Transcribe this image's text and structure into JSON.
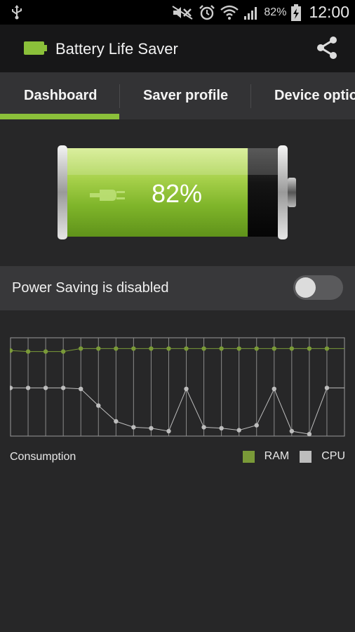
{
  "status_bar": {
    "battery_percent": "82%",
    "time": "12:00",
    "icons": [
      "usb-icon",
      "mute-icon",
      "alarm-icon",
      "wifi-icon",
      "signal-icon",
      "battery-charging-icon"
    ]
  },
  "app": {
    "title": "Battery Life Saver",
    "icon": "battery-icon",
    "share_icon": "share-icon"
  },
  "tabs": [
    {
      "label": "Dashboard",
      "selected": true
    },
    {
      "label": "Saver profile",
      "selected": false
    },
    {
      "label": "Device options",
      "selected": false
    }
  ],
  "battery": {
    "level_text": "82%",
    "level_fraction": 0.82,
    "plug_icon": "plug-icon"
  },
  "power_saving": {
    "label": "Power Saving is disabled",
    "enabled": false
  },
  "colors": {
    "accent": "#8bc03a",
    "ram": "#7a9a38",
    "cpu": "#bdbdbd"
  },
  "chart_data": {
    "type": "line",
    "x": [
      1,
      2,
      3,
      4,
      5,
      6,
      7,
      8,
      9,
      10,
      11,
      12,
      13,
      14,
      15,
      16,
      17,
      18,
      19
    ],
    "series": [
      {
        "name": "RAM",
        "values": [
          87,
          86,
          86,
          86,
          89,
          89,
          89,
          89,
          89,
          89,
          89,
          89,
          89,
          89,
          89,
          89,
          89,
          89,
          89
        ]
      },
      {
        "name": "CPU",
        "values": [
          49,
          49,
          49,
          49,
          48,
          31,
          15,
          9,
          8,
          5,
          48,
          9,
          8,
          6,
          11,
          48,
          5,
          2,
          49
        ]
      }
    ],
    "ylim": [
      0,
      100
    ],
    "grid": true,
    "legend": "bottom-right",
    "legend_title": "Consumption"
  }
}
